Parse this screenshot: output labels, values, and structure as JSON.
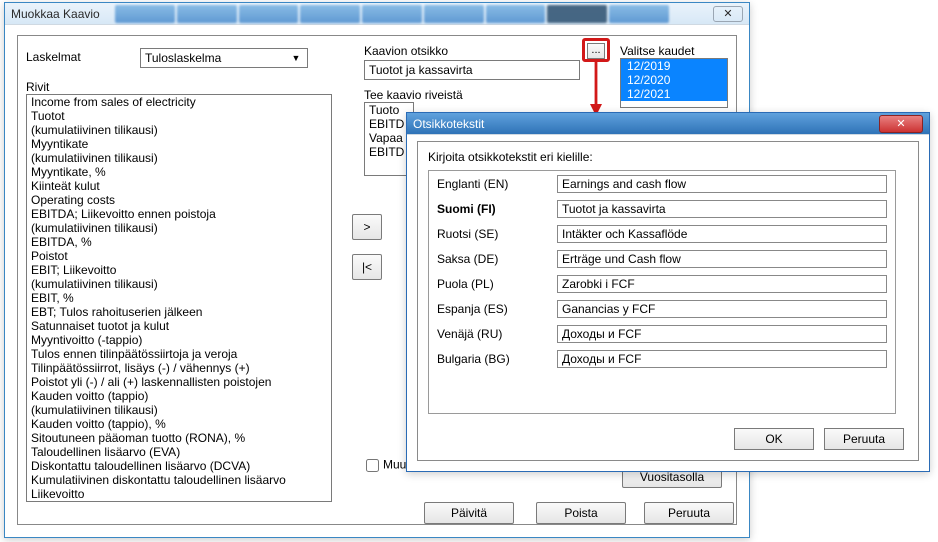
{
  "main": {
    "title": "Muokkaa Kaavio",
    "labels": {
      "laskelmat": "Laskelmat",
      "rivit": "Rivit",
      "kaavion_otsikko": "Kaavion otsikko",
      "tee_kaavio": "Tee kaavio riveistä",
      "valitse_kaudet": "Valitse kaudet"
    },
    "dropdown_value": "Tuloslaskelma",
    "title_value": "Tuotot ja kassavirta",
    "rows": [
      "Income from sales of electricity",
      "Tuotot",
      "(kumulatiivinen tilikausi)",
      "Myyntikate",
      "(kumulatiivinen tilikausi)",
      "Myyntikate, %",
      "Kiinteät kulut",
      "Operating costs",
      "EBITDA; Liikevoitto ennen poistoja",
      "(kumulatiivinen tilikausi)",
      "EBITDA, %",
      "Poistot",
      "EBIT; Liikevoitto",
      "(kumulatiivinen tilikausi)",
      "EBIT, %",
      "EBT; Tulos rahoituserien jälkeen",
      "Satunnaiset tuotot ja kulut",
      "Myyntivoitto (-tappio)",
      "Tulos ennen tilinpäätössiirtoja ja veroja",
      "Tilinpäätössiirrot, lisäys (-) / vähennys (+)",
      "Poistot yli (-) / ali (+) laskennallisten poistojen",
      "Kauden voitto (tappio)",
      "(kumulatiivinen tilikausi)",
      "Kauden voitto (tappio), %",
      "Sitoutuneen pääoman tuotto (RONA), %",
      "Taloudellinen lisäarvo (EVA)",
      "Diskontattu taloudellinen lisäarvo (DCVA)",
      "Kumulatiivinen diskontattu taloudellinen lisäarvo",
      "Liikevoitto"
    ],
    "chart_rows": [
      "Tuoto",
      "EBITD",
      "Vapaa",
      "EBITD"
    ],
    "periods": [
      "12/2019",
      "12/2020",
      "12/2021"
    ],
    "ellipsis": "...",
    "buttons": {
      "forward": ">",
      "back": "|<",
      "muu_chk": "Muu",
      "vuositasolla": "Vuositasolla",
      "paivita": "Päivitä",
      "poista": "Poista",
      "peruuta": "Peruuta",
      "close_x": "✕"
    }
  },
  "modal": {
    "title": "Otsikkotekstit",
    "instruction": "Kirjoita otsikkotekstit eri kielille:",
    "langs": [
      {
        "label": "Englanti (EN)",
        "value": "Earnings and cash flow",
        "current": false
      },
      {
        "label": "Suomi (FI)",
        "value": "Tuotot ja kassavirta",
        "current": true
      },
      {
        "label": "Ruotsi (SE)",
        "value": "Intäkter och Kassaflöde",
        "current": false
      },
      {
        "label": "Saksa (DE)",
        "value": "Erträge und Cash flow",
        "current": false
      },
      {
        "label": "Puola (PL)",
        "value": "Zarobki i FCF",
        "current": false
      },
      {
        "label": "Espanja (ES)",
        "value": "Ganancias y FCF",
        "current": false
      },
      {
        "label": "Venäjä (RU)",
        "value": "Доходы и FCF",
        "current": false
      },
      {
        "label": "Bulgaria (BG)",
        "value": "Доходы и FCF",
        "current": false
      }
    ],
    "ok": "OK",
    "cancel": "Peruuta",
    "close_x": "✕"
  }
}
